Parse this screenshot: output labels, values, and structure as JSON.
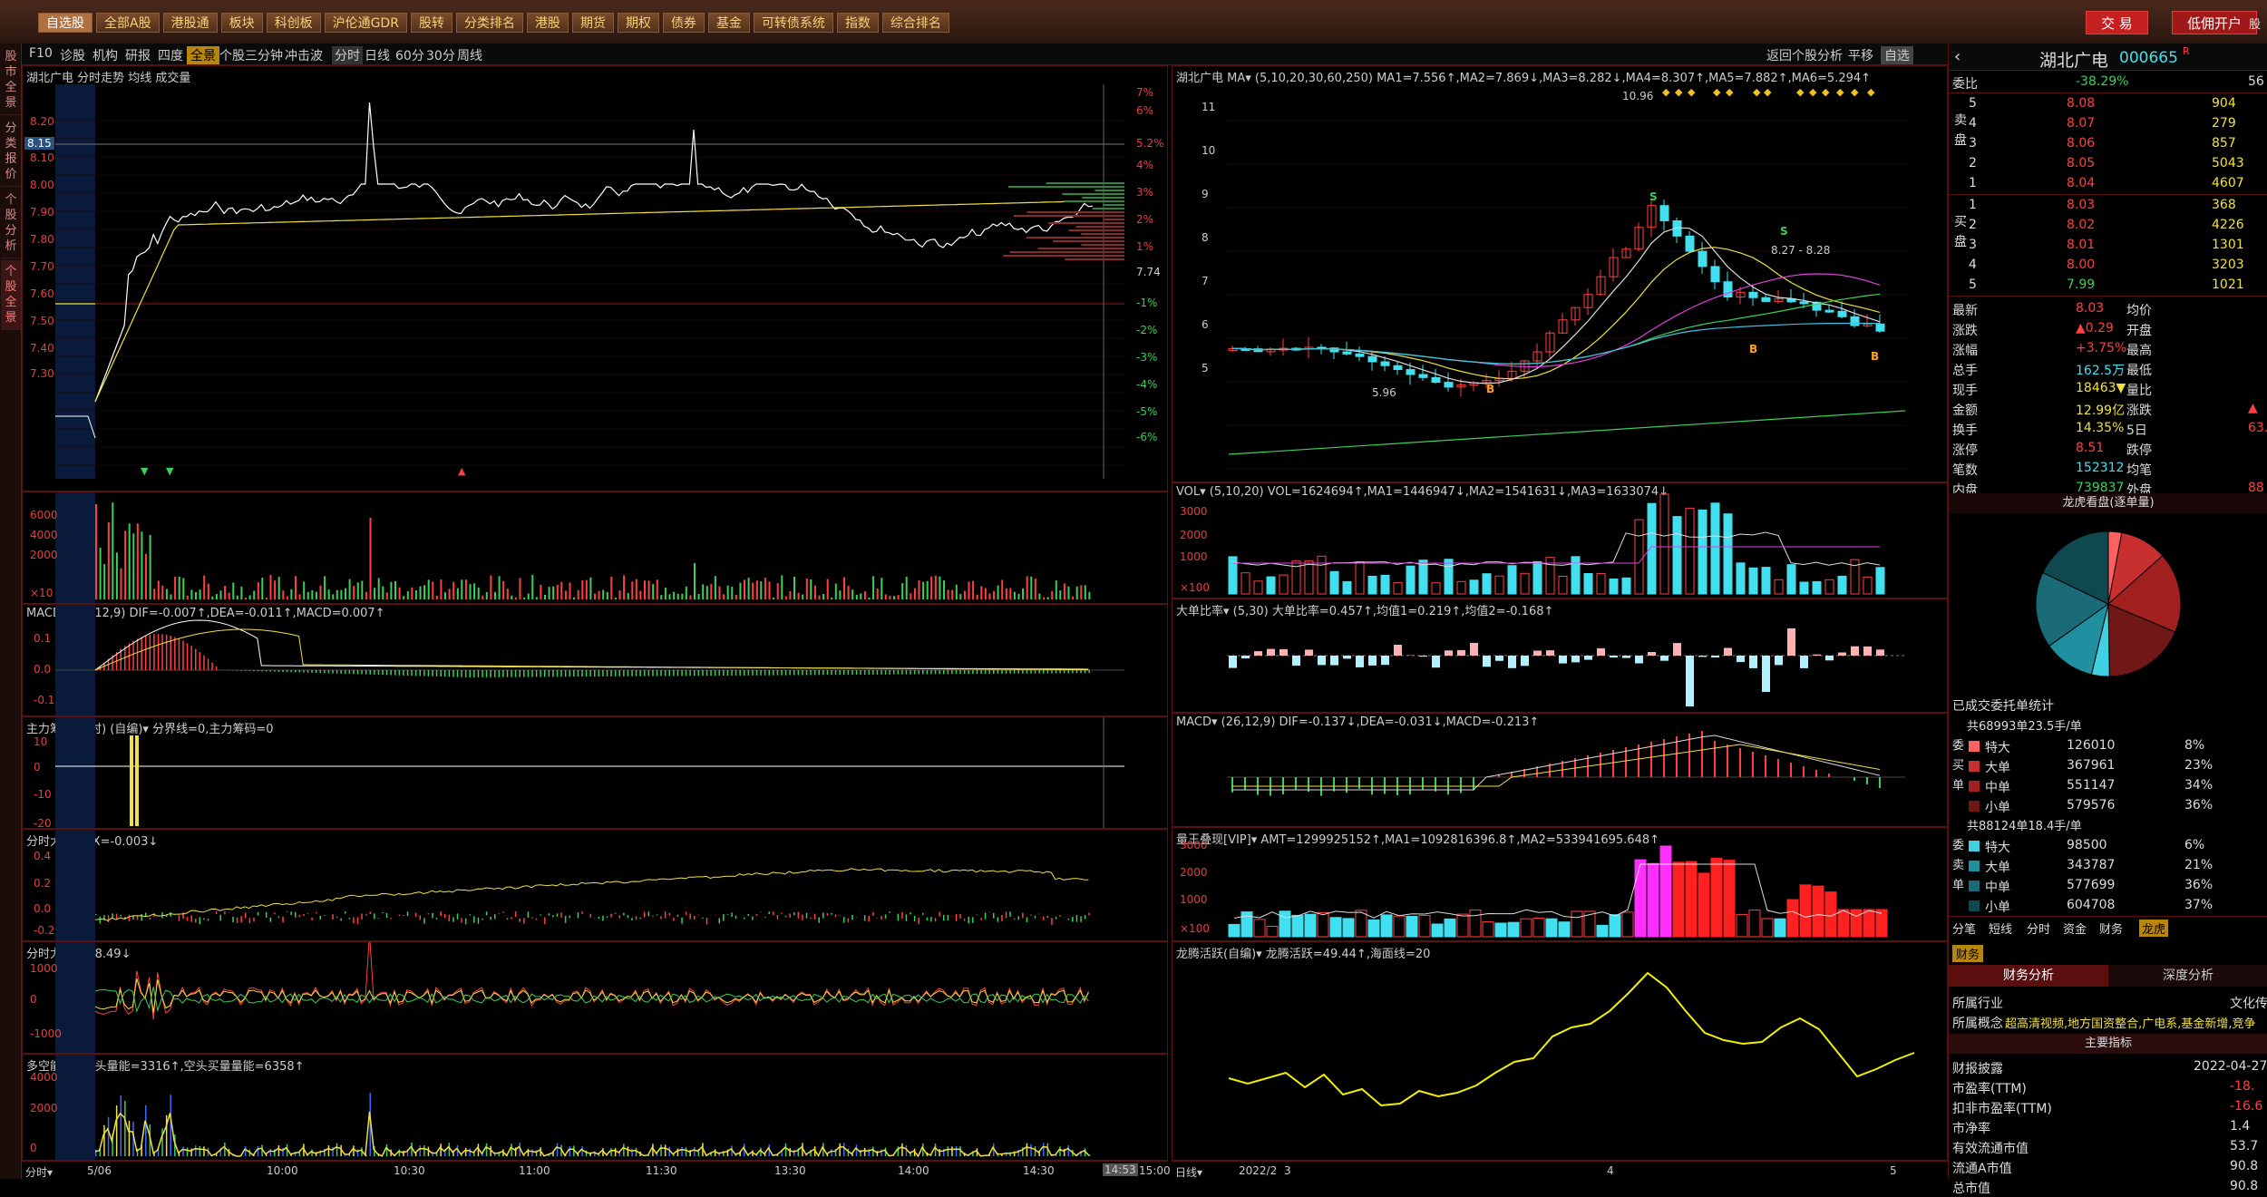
{
  "topbar": {
    "menus": [
      "自选股",
      "全部A股",
      "港股通",
      "板块",
      "科创板",
      "沪伦通GDR",
      "股转",
      "分类排名",
      "港股",
      "期货",
      "期权",
      "债券",
      "基金",
      "可转债系统",
      "指数",
      "综合排名"
    ],
    "btn_trade": "交 易",
    "btn_open": "低佣开户",
    "btn_more": "股"
  },
  "leftstrip": {
    "tabs": [
      "股市全景",
      "分类报价",
      "个股分析",
      "个股全景"
    ]
  },
  "toolbar": {
    "left_items": [
      "F10",
      "诊股",
      "机构",
      "研报",
      "四度",
      "全景",
      "个股三分钟",
      "冲击波"
    ],
    "mid_items": [
      "分时",
      "日线",
      "60分",
      "30分",
      "周线"
    ],
    "right_items": [
      "返回个股分析",
      "平移",
      "自选"
    ]
  },
  "left": {
    "intraday_title": "湖北广电 分时走势 均线 成交量",
    "price_ticks": [
      "8.20",
      "8.15",
      "8.10",
      "8.00",
      "7.90",
      "7.80",
      "7.70",
      "7.60",
      "7.50",
      "7.40",
      "7.30"
    ],
    "pct_ticks": [
      "7%",
      "6%",
      "5.2%",
      "4%",
      "3%",
      "2%",
      "1%",
      "7.74",
      "-1%",
      "-2%",
      "-3%",
      "-4%",
      "-5%",
      "-6%"
    ],
    "current_price_tag": "8.15",
    "vol_ticks": [
      "6000",
      "4000",
      "2000",
      "×10"
    ],
    "macd_title": "MACD▾ (26,12,9) DIF=-0.007↑,DEA=-0.011↑,MACD=0.007↑",
    "macd_ticks": [
      "0.1",
      "0.0",
      "-0.1"
    ],
    "zl_title": "主力筹码(分时) (自编)▾ 分界线=0,主力筹码=0",
    "zl_ticks": [
      "10",
      "0",
      "-10",
      "-20"
    ],
    "dd_title": "分时大单▾ DX=-0.003↓",
    "dd_ticks": [
      "0.4",
      "0.2",
      "0.0",
      "-0.2"
    ],
    "ld_title": "分时力道▾ -28.49↓",
    "ld_ticks": [
      "1000",
      "0",
      "-1000"
    ],
    "dk_title": "多空能量▾ 多头量能=3316↑,空头买量量能=6358↑",
    "dk_ticks": [
      "4000",
      "2000",
      "0"
    ],
    "time_labels": [
      "分时▾",
      "5/06",
      "10:00",
      "10:30",
      "11:00",
      "11:30",
      "13:30",
      "14:00",
      "14:30",
      "14:53",
      "15:00"
    ]
  },
  "mid": {
    "kline_title": "湖北广电 MA▾ (5,10,20,30,60,250) MA1=7.556↑,MA2=7.869↓,MA3=8.282↓,MA4=8.307↑,MA5=7.882↑,MA6=5.294↑",
    "price_ticks": [
      "11",
      "10",
      "9",
      "8",
      "7",
      "6",
      "5"
    ],
    "annot_high": "10.96",
    "annot_low": "5.96",
    "annot_range": "8.27 - 8.28",
    "vol_title": "VOL▾ (5,10,20) VOL=1624694↑,MA1=1446947↓,MA2=1541631↓,MA3=1633074↓",
    "vol_ticks": [
      "3000",
      "2000",
      "1000",
      "×100"
    ],
    "dd_title": "大单比率▾ (5,30) 大单比率=0.457↑,均值1=0.219↑,均值2=-0.168↑",
    "macd_title": "MACD▾ (26,12,9) DIF=-0.137↓,DEA=-0.031↓,MACD=-0.213↑",
    "lw_title": "量王叠现[VIP]▾ AMT=1299925152↑,MA1=1092816396.8↑,MA2=533941695.648↑",
    "lw_ticks": [
      "3000",
      "2000",
      "1000",
      "×100"
    ],
    "lt_title": "龙腾活跃(自编)▾ 龙腾活跃=49.44↑,海面线=20",
    "date_labels": [
      "日线▾",
      "2022/2",
      "3",
      "4",
      "5"
    ]
  },
  "right": {
    "stock_name": "湖北广电",
    "stock_code": "000665",
    "stock_suffix": "R",
    "weibi_label": "委比",
    "weibi_val": "-38.29%",
    "weicha_val": "56",
    "sell": [
      {
        "lvl": "5",
        "price": "8.08",
        "vol": "904"
      },
      {
        "lvl": "4",
        "price": "8.07",
        "vol": "279"
      },
      {
        "lvl": "3",
        "price": "8.06",
        "vol": "857"
      },
      {
        "lvl": "2",
        "price": "8.05",
        "vol": "5043"
      },
      {
        "lvl": "1",
        "price": "8.04",
        "vol": "4607"
      }
    ],
    "buy": [
      {
        "lvl": "1",
        "price": "8.03",
        "vol": "368"
      },
      {
        "lvl": "2",
        "price": "8.02",
        "vol": "4226"
      },
      {
        "lvl": "3",
        "price": "8.01",
        "vol": "1301"
      },
      {
        "lvl": "4",
        "price": "8.00",
        "vol": "3203"
      },
      {
        "lvl": "5",
        "price": "7.99",
        "vol": "1021"
      }
    ],
    "side_sell": "卖 盘",
    "side_buy": "买 盘",
    "quote": [
      {
        "l": "最新",
        "v": "8.03",
        "l2": "均价",
        "v2": ""
      },
      {
        "l": "涨跌",
        "v": "▲0.29",
        "l2": "开盘",
        "v2": ""
      },
      {
        "l": "涨幅",
        "v": "+3.75%",
        "l2": "最高",
        "v2": ""
      },
      {
        "l": "总手",
        "v": "162.5万",
        "l2": "最低",
        "v2": ""
      },
      {
        "l": "现手",
        "v": "18463▼",
        "l2": "量比",
        "v2": ""
      },
      {
        "l": "金额",
        "v": "12.99亿",
        "l2": "涨跌",
        "v2": "▲"
      },
      {
        "l": "换手",
        "v": "14.35%",
        "l2": "5日",
        "v2": "63."
      },
      {
        "l": "涨停",
        "v": "8.51",
        "l2": "跌停",
        "v2": ""
      },
      {
        "l": "笔数",
        "v": "152312",
        "l2": "均笔",
        "v2": ""
      },
      {
        "l": "内盘",
        "v": "739837",
        "l2": "外盘",
        "v2": "88"
      }
    ],
    "pie_title": "龙虎看盘(逐单量)",
    "pie_slices": [
      {
        "name": "买特大",
        "pct": 6,
        "color": "#ff6060"
      },
      {
        "name": "买大单",
        "pct": 21,
        "color": "#c83030"
      },
      {
        "name": "买中单",
        "pct": 36,
        "color": "#a02020"
      },
      {
        "name": "买小单",
        "pct": 37,
        "color": "#701818"
      },
      {
        "name": "卖特大",
        "pct": 8,
        "color": "#40d0e0"
      },
      {
        "name": "卖大单",
        "pct": 23,
        "color": "#2090a0"
      },
      {
        "name": "卖中单",
        "pct": 34,
        "color": "#1a6a78"
      },
      {
        "name": "卖小单",
        "pct": 36,
        "color": "#104850"
      }
    ],
    "stat_title": "已成交委托单统计",
    "buy_summary": "共68993单23.5手/单",
    "buy_rows": [
      {
        "t": "特大",
        "v": "126010",
        "p": "8%"
      },
      {
        "t": "大单",
        "v": "367961",
        "p": "23%"
      },
      {
        "t": "中单",
        "v": "551147",
        "p": "34%"
      },
      {
        "t": "小单",
        "v": "579576",
        "p": "36%"
      }
    ],
    "sell_summary": "共88124单18.4手/单",
    "sell_rows": [
      {
        "t": "特大",
        "v": "98500",
        "p": "6%"
      },
      {
        "t": "大单",
        "v": "343787",
        "p": "21%"
      },
      {
        "t": "中单",
        "v": "577699",
        "p": "36%"
      },
      {
        "t": "小单",
        "v": "604708",
        "p": "37%"
      }
    ],
    "side_buy_label": "委 买 单",
    "side_sell_label": "委 卖 单",
    "tabs": [
      "分笔",
      "短线",
      "分时",
      "资金",
      "财务",
      "龙虎"
    ],
    "fin_tab": "财务",
    "fin_head_left": "财务分析",
    "fin_head_right": "深度分析",
    "industry_label": "所属行业",
    "industry_val": "文化传",
    "concept_label": "所属概念",
    "concept_val": "超高清视频,地方国资整合,广电系,基金新增,竞争",
    "main_index": "主要指标",
    "fin_rows": [
      {
        "l": "财报披露",
        "v": "2022-04-27"
      },
      {
        "l": "市盈率(TTM)",
        "v": "-18."
      },
      {
        "l": "扣非市盈率(TTM)",
        "v": "-16.6"
      },
      {
        "l": "市净率",
        "v": "1.4"
      },
      {
        "l": "有效流通市值",
        "v": "53.7"
      },
      {
        "l": "流通A市值",
        "v": "90.8"
      },
      {
        "l": "总市值",
        "v": "90.8"
      }
    ]
  },
  "colors": {
    "up": "#ff4040",
    "down": "#40e0f0",
    "ma_yellow": "#f0e040",
    "bg": "#000000",
    "grid": "#5a1010"
  }
}
